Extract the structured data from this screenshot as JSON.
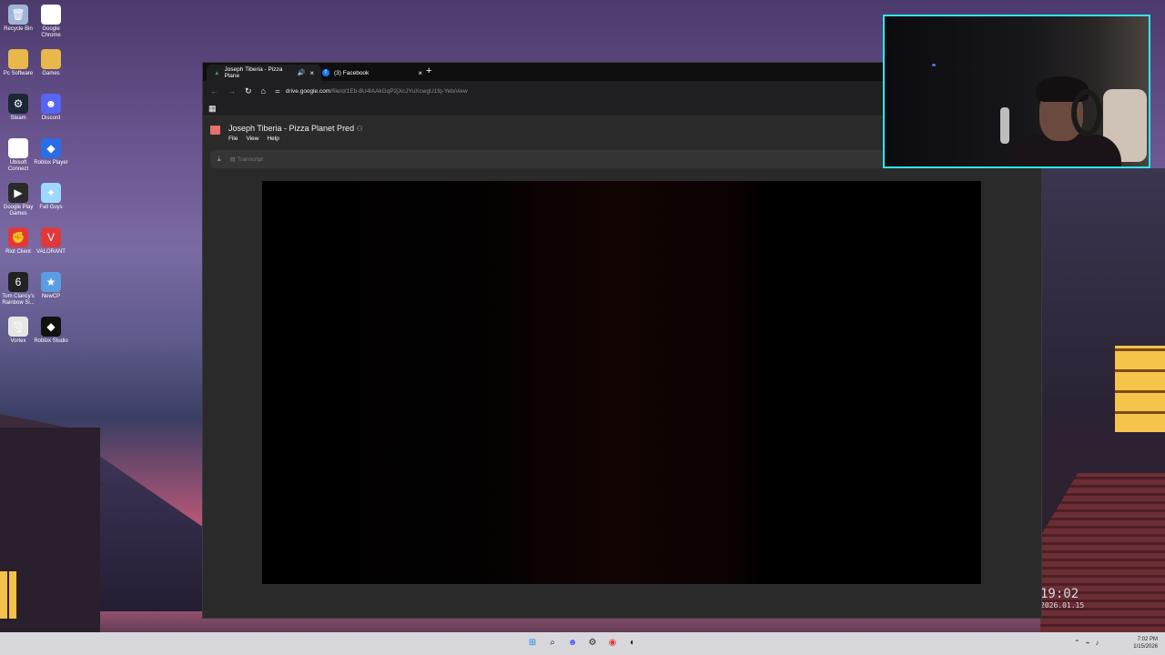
{
  "desktop": {
    "icons": [
      {
        "label": "Recycle Bin",
        "icon": "recycle-bin-icon",
        "color": "#9fb5d6",
        "glyph": "🗑"
      },
      {
        "label": "Google Chrome",
        "icon": "chrome-icon",
        "color": "#ffffff",
        "glyph": "◉"
      },
      {
        "label": "Pc Software",
        "icon": "folder-icon",
        "color": "#e9b84a",
        "glyph": ""
      },
      {
        "label": "Games",
        "icon": "folder-icon",
        "color": "#e9b84a",
        "glyph": ""
      },
      {
        "label": "Steam",
        "icon": "steam-icon",
        "color": "#1b2838",
        "glyph": "⚙"
      },
      {
        "label": "Discord",
        "icon": "discord-icon",
        "color": "#5865f2",
        "glyph": "☻"
      },
      {
        "label": "Ubisoft Connect",
        "icon": "ubisoft-icon",
        "color": "#ffffff",
        "glyph": "◎"
      },
      {
        "label": "Roblox Player",
        "icon": "roblox-icon",
        "color": "#2a6de8",
        "glyph": "◆"
      },
      {
        "label": "Google Play Games",
        "icon": "google-play-icon",
        "color": "#2a2a2a",
        "glyph": "▶"
      },
      {
        "label": "Fall Guys",
        "icon": "fall-guys-icon",
        "color": "#9ed8ff",
        "glyph": "✦"
      },
      {
        "label": "Riot Client",
        "icon": "riot-icon",
        "color": "#e1393b",
        "glyph": "✊"
      },
      {
        "label": "VALORANT",
        "icon": "valorant-icon",
        "color": "#e1393b",
        "glyph": "V"
      },
      {
        "label": "Tom Clancy's Rainbow Si...",
        "icon": "rainbow-six-icon",
        "color": "#222222",
        "glyph": "6"
      },
      {
        "label": "NewCP",
        "icon": "newcp-icon",
        "color": "#5a9de0",
        "glyph": "★"
      },
      {
        "label": "Vortex",
        "icon": "vortex-icon",
        "color": "#e6e6e6",
        "glyph": "🌪"
      },
      {
        "label": "Roblox Studio",
        "icon": "roblox-studio-icon",
        "color": "#111111",
        "glyph": "◆"
      }
    ],
    "clock_widget": {
      "time": "19:02",
      "date": "2026.01.15"
    }
  },
  "browser": {
    "tabs": [
      {
        "title": "Joseph Tiberia - Pizza Plane",
        "icon": "drive-icon",
        "active": true
      },
      {
        "title": "(3) Facebook",
        "icon": "facebook-icon",
        "active": false
      }
    ],
    "new_tab": "+",
    "url_host": "drive.google.com",
    "url_path": "/file/d/1Eb-8U4lAAkGqP2jXcJYuXcwgU1fq-Yeb/view",
    "nav": {
      "back": "←",
      "forward": "→",
      "reload": "↻",
      "home": "⌂"
    },
    "apps_glyph": "▦"
  },
  "drive": {
    "file_title": "Joseph Tiberia - Pizza Planet Pred",
    "menus": [
      "File",
      "View",
      "Help"
    ],
    "transcript_label": "Transcript"
  },
  "taskbar": {
    "time": "7:02 PM",
    "date": "1/15/2026"
  }
}
